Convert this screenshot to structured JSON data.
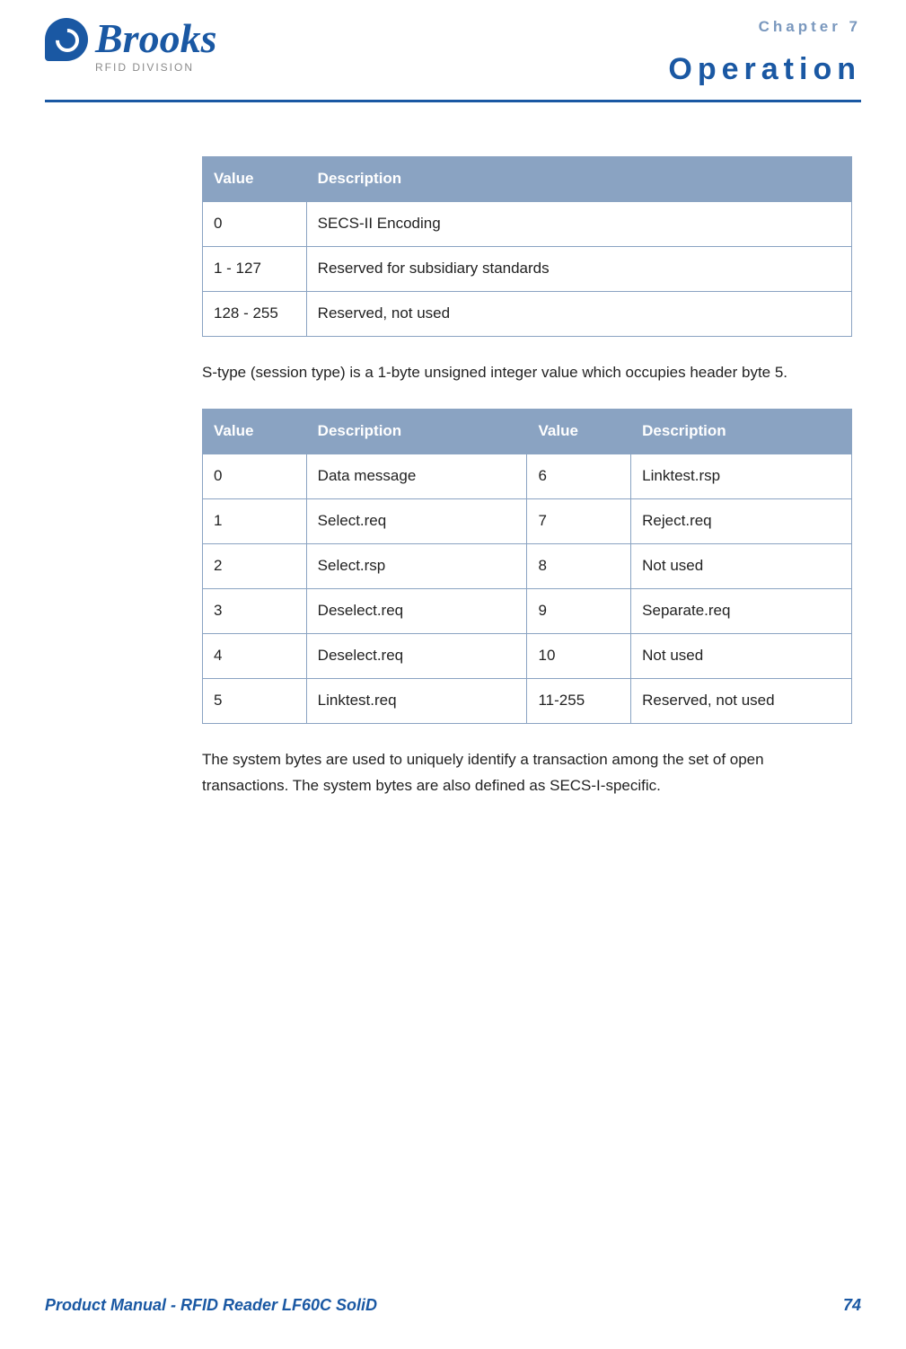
{
  "header": {
    "logo_text": "Brooks",
    "logo_sub": "RFID DIVISION",
    "chapter_label": "Chapter 7",
    "chapter_title": "Operation"
  },
  "table1": {
    "headers": [
      "Value",
      "Description"
    ],
    "rows": [
      {
        "value": "0",
        "desc": "SECS-II Encoding"
      },
      {
        "value": "1 - 127",
        "desc": "Reserved for subsidiary standards"
      },
      {
        "value": "128 - 255",
        "desc": "Reserved, not used"
      }
    ]
  },
  "para1": "S-type (session type) is a 1-byte unsigned integer value which occupies header byte 5.",
  "table2": {
    "headers": [
      "Value",
      "Description",
      "Value",
      "Description"
    ],
    "rows": [
      {
        "v1": "0",
        "d1": "Data message",
        "v2": "6",
        "d2": "Linktest.rsp"
      },
      {
        "v1": "1",
        "d1": "Select.req",
        "v2": "7",
        "d2": "Reject.req"
      },
      {
        "v1": "2",
        "d1": "Select.rsp",
        "v2": "8",
        "d2": "Not used"
      },
      {
        "v1": "3",
        "d1": "Deselect.req",
        "v2": "9",
        "d2": "Separate.req"
      },
      {
        "v1": "4",
        "d1": "Deselect.req",
        "v2": "10",
        "d2": "Not used"
      },
      {
        "v1": "5",
        "d1": "Linktest.req",
        "v2": "11-255",
        "d2": "Reserved, not used"
      }
    ]
  },
  "para2": "The system bytes are used to uniquely identify a transaction among the set of open transactions. The system bytes are also defined as SECS-I-specific.",
  "footer": {
    "left": "Product Manual - RFID Reader LF60C SoliD",
    "right": "74"
  }
}
